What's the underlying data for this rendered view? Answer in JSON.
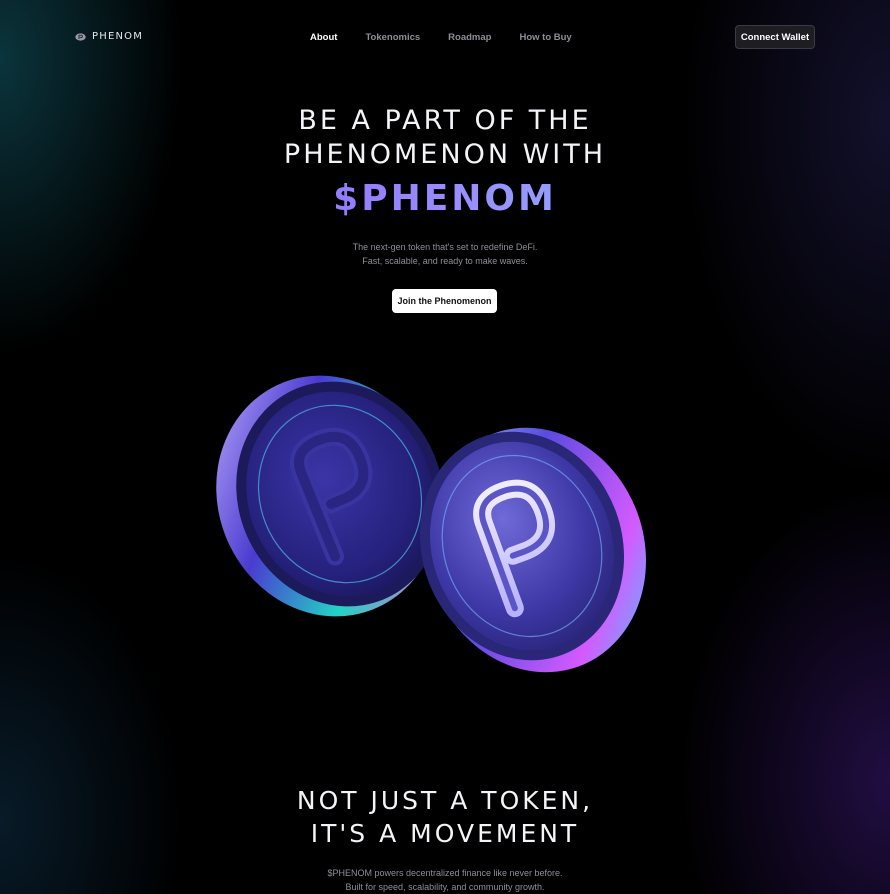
{
  "nav": {
    "logo_text": "PHENOM",
    "links": [
      {
        "label": "About",
        "active": true
      },
      {
        "label": "Tokenomics",
        "active": false
      },
      {
        "label": "Roadmap",
        "active": false
      },
      {
        "label": "How to Buy",
        "active": false
      }
    ],
    "connect_label": "Connect Wallet"
  },
  "hero": {
    "title_line1": "BE A PART OF THE",
    "title_line2": "PHENOMENON WITH",
    "token": "$PHENOM",
    "subtitle_line1": "The next-gen token that's set to redefine DeFi.",
    "subtitle_line2": "Fast, scalable, and ready to make waves.",
    "cta_label": "Join the Phenomenon"
  },
  "section2": {
    "title_line1": "NOT JUST A TOKEN,",
    "title_line2": "IT'S A MOVEMENT",
    "subtitle_line1": "$PHENOM powers decentralized finance like never before.",
    "subtitle_line2": "Built for speed, scalability, and community growth."
  },
  "colors": {
    "accent_purple": "#7b4bff",
    "accent_cyan": "#7fd8ff",
    "background": "#000000"
  },
  "icons": {
    "logo": "phenom-logo-icon",
    "coin_front": "phenom-coin",
    "coin_back": "phenom-coin"
  }
}
